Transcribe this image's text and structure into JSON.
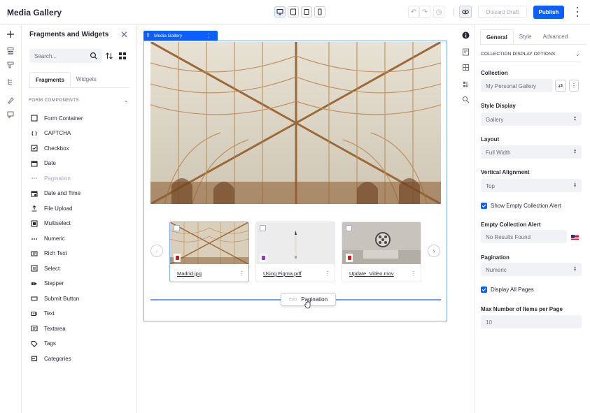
{
  "app": {
    "title": "Media Gallery",
    "discard_label": "Discard Draft",
    "publish_label": "Publish"
  },
  "colors": {
    "primary": "#0b5fff",
    "selection": "#80acff",
    "text": "#272833",
    "muted": "#6b6c7e",
    "field_bg": "#f1f2f5"
  },
  "left_panel": {
    "title": "Fragments and Widgets",
    "search_placeholder": "Search...",
    "tabs": [
      {
        "label": "Fragments",
        "active": true
      },
      {
        "label": "Widgets",
        "active": false
      }
    ],
    "section": "FORM COMPONENTS",
    "items": [
      {
        "label": "Form Container",
        "icon": "square-icon",
        "disabled": false
      },
      {
        "label": "CAPTCHA",
        "icon": "captcha-icon",
        "disabled": false
      },
      {
        "label": "Checkbox",
        "icon": "checkbox-icon",
        "disabled": false
      },
      {
        "label": "Date",
        "icon": "calendar-icon",
        "disabled": false
      },
      {
        "label": "Pagination",
        "icon": "pagination-icon",
        "disabled": true
      },
      {
        "label": "Date and Time",
        "icon": "calendar-clock-icon",
        "disabled": false
      },
      {
        "label": "File Upload",
        "icon": "upload-icon",
        "disabled": false
      },
      {
        "label": "Multiselect",
        "icon": "multiselect-icon",
        "disabled": false
      },
      {
        "label": "Numeric",
        "icon": "numeric-icon",
        "disabled": false
      },
      {
        "label": "Rich Text",
        "icon": "rich-text-icon",
        "disabled": false
      },
      {
        "label": "Select",
        "icon": "select-icon",
        "disabled": false
      },
      {
        "label": "Stepper",
        "icon": "stepper-icon",
        "disabled": false
      },
      {
        "label": "Submit Button",
        "icon": "button-icon",
        "disabled": false
      },
      {
        "label": "Text",
        "icon": "text-icon",
        "disabled": false
      },
      {
        "label": "Textarea",
        "icon": "textarea-icon",
        "disabled": false
      },
      {
        "label": "Tags",
        "icon": "tag-icon",
        "disabled": false
      },
      {
        "label": "Categories",
        "icon": "categories-icon",
        "disabled": false
      }
    ]
  },
  "canvas": {
    "fragment_label": "Media Gallery",
    "cards": [
      {
        "filename": "Madrid.jpg",
        "type_color": "#da1414",
        "selected": true
      },
      {
        "filename": "Using Figma.pdf",
        "type_color": "#8c3ad0",
        "selected": false
      },
      {
        "filename": "Update_Video.mov",
        "type_color": "#da1414",
        "selected": false
      }
    ],
    "pagination_chip": "Pagination"
  },
  "config_panel": {
    "tabs": [
      {
        "label": "General",
        "active": true
      },
      {
        "label": "Style",
        "active": false
      },
      {
        "label": "Advanced",
        "active": false
      }
    ],
    "section": "COLLECTION DISPLAY OPTIONS",
    "collection_label": "Collection",
    "collection_value": "My Personal Gallery",
    "style_display_label": "Style Display",
    "style_display_value": "Gallery",
    "layout_label": "Layout",
    "layout_value": "Full Width",
    "valign_label": "Vertical Alignment",
    "valign_value": "Top",
    "show_empty_label": "Show Empty Collection Alert",
    "show_empty_checked": true,
    "empty_alert_label": "Empty Collection Alert",
    "empty_alert_value": "No Results Found",
    "pagination_label": "Pagination",
    "pagination_value": "Numeric",
    "display_all_label": "Display All Pages",
    "display_all_checked": true,
    "max_items_label": "Max Number of Items per Page",
    "max_items_value": "10"
  }
}
